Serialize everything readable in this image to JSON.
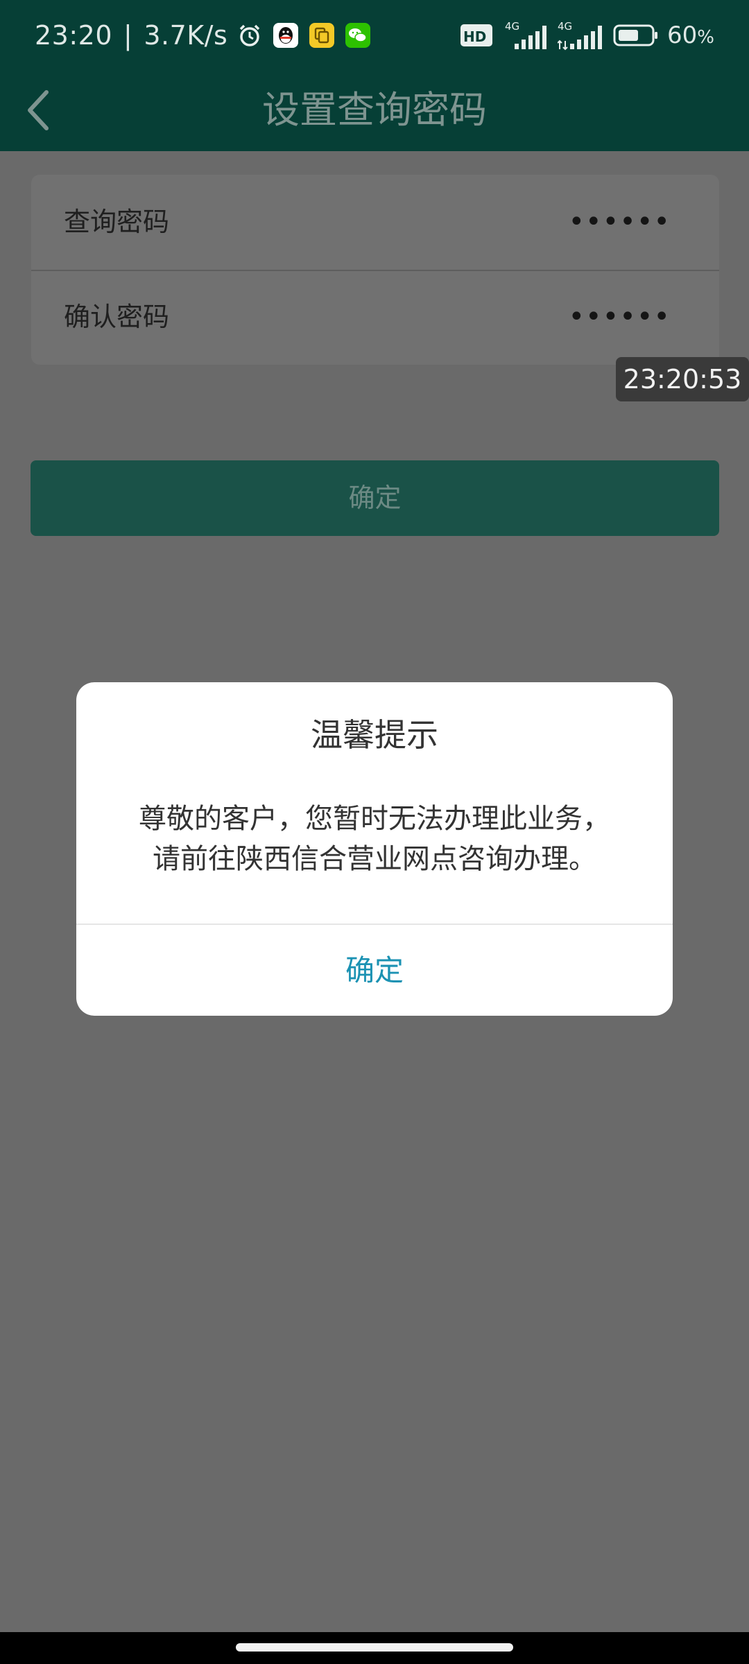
{
  "status_bar": {
    "time": "23:20",
    "separator": "|",
    "network_speed": "3.7K/s",
    "icons_left": [
      "alarm-icon",
      "qq-icon",
      "files-icon",
      "wechat-icon"
    ],
    "icons_right": [
      "hd-icon",
      "signal-4g-icon",
      "signal-4g-icon",
      "battery-icon"
    ],
    "hd_label": "HD",
    "network_type_1": "4G",
    "network_type_2": "4G",
    "battery_value": "60",
    "battery_unit": "%"
  },
  "nav": {
    "title": "设置查询密码",
    "back_icon": "chevron-left-icon"
  },
  "form": {
    "rows": [
      {
        "label": "查询密码",
        "value": "••••••"
      },
      {
        "label": "确认密码",
        "value": "••••••"
      }
    ]
  },
  "time_badge": "23:20:53",
  "confirm_button": "确定",
  "dialog": {
    "title": "温馨提示",
    "message_line1": "尊敬的客户，您暂时无法办理此业务，",
    "message_line2": "请前往陕西信合营业网点咨询办理。",
    "button": "确定"
  },
  "colors": {
    "header": "#063f36",
    "overlay": "#6a6a6a",
    "dialog_button": "#1b92b3"
  }
}
